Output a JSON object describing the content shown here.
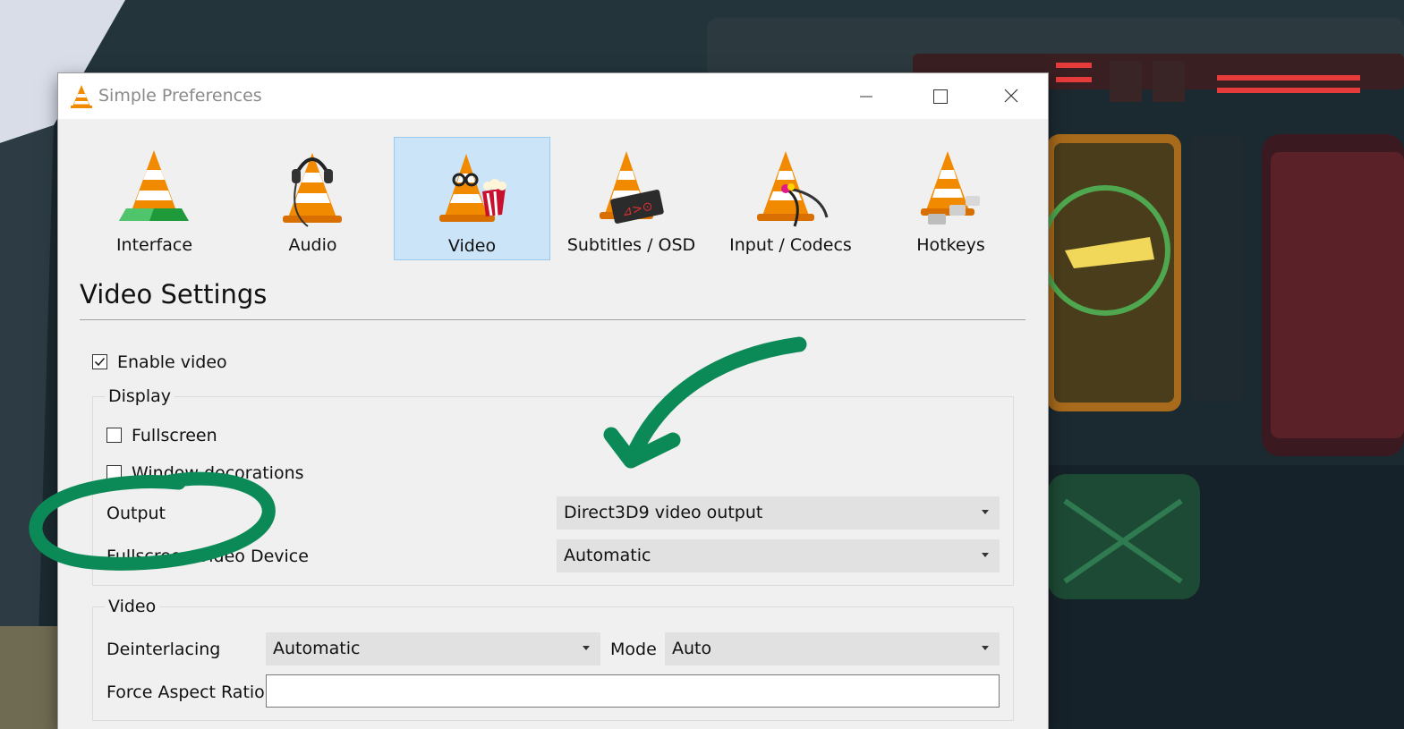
{
  "window": {
    "title": "Simple Preferences",
    "buttons": {
      "minimize": "minimize-icon",
      "maximize": "maximize-icon",
      "close": "close-icon"
    }
  },
  "categories": [
    {
      "label": "Interface",
      "icon": "vlc-cone-interface-icon",
      "selected": false
    },
    {
      "label": "Audio",
      "icon": "vlc-cone-headphones-icon",
      "selected": false
    },
    {
      "label": "Video",
      "icon": "vlc-cone-glasses-popcorn-icon",
      "selected": true
    },
    {
      "label": "Subtitles / OSD",
      "icon": "vlc-cone-subtitles-icon",
      "selected": false
    },
    {
      "label": "Input / Codecs",
      "icon": "vlc-cone-cables-icon",
      "selected": false
    },
    {
      "label": "Hotkeys",
      "icon": "vlc-cone-keys-icon",
      "selected": false
    }
  ],
  "video_settings": {
    "title": "Video Settings",
    "enable_video": {
      "label": "Enable video",
      "checked": true
    },
    "display": {
      "title": "Display",
      "fullscreen": {
        "label": "Fullscreen",
        "checked": false
      },
      "window_decorations": {
        "label": "Window decorations",
        "checked": false
      },
      "output": {
        "label": "Output",
        "value": "Direct3D9 video output"
      },
      "fullscreen_device": {
        "label": "Fullscreen Video Device",
        "value": "Automatic"
      }
    },
    "video": {
      "title": "Video",
      "deinterlacing": {
        "label": "Deinterlacing",
        "value": "Automatic"
      },
      "mode": {
        "label": "Mode",
        "value": "Auto"
      },
      "force_aspect_ratio": {
        "label": "Force Aspect Ratio",
        "value": ""
      }
    }
  },
  "colors": {
    "selection_bg": "#cce4f7",
    "selection_border": "#99c9ef",
    "annotation": "#0b8a57",
    "vlc_orange": "#f28a00"
  }
}
